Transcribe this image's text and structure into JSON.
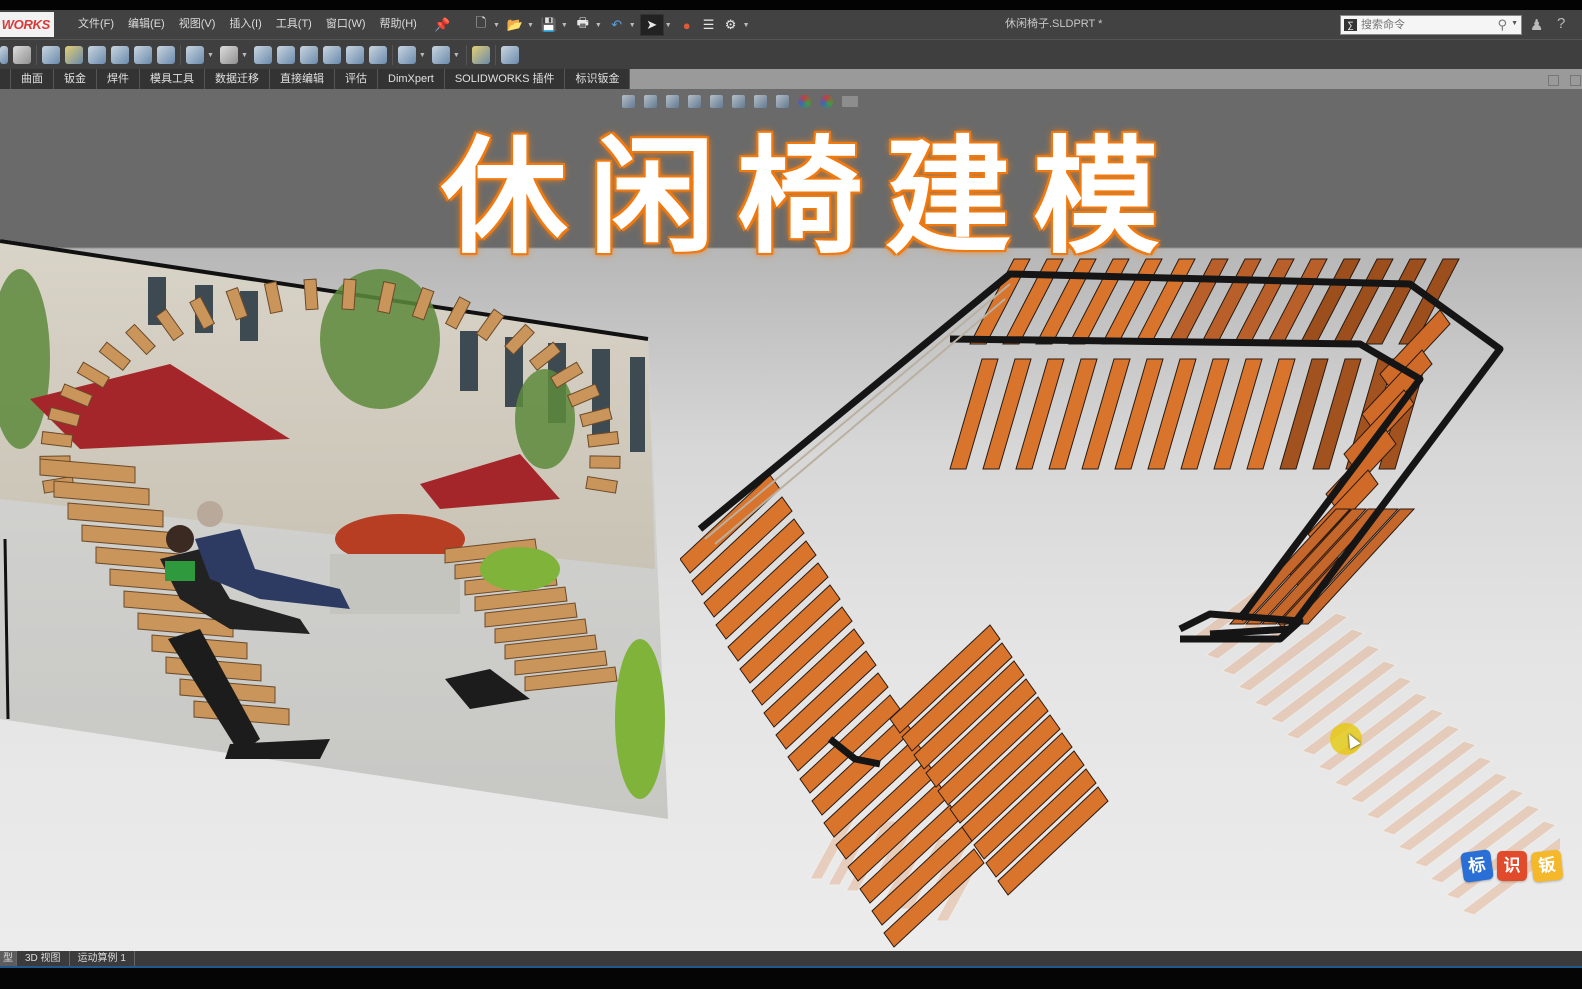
{
  "app": {
    "logo_text": "WORKS",
    "document_title": "休闲椅子.SLDPRT *"
  },
  "menu": [
    {
      "label": "文件(F)"
    },
    {
      "label": "编辑(E)"
    },
    {
      "label": "视图(V)"
    },
    {
      "label": "插入(I)"
    },
    {
      "label": "工具(T)"
    },
    {
      "label": "窗口(W)"
    },
    {
      "label": "帮助(H)"
    }
  ],
  "quick_access": [
    "new-document-icon",
    "open-icon",
    "save-icon",
    "print-icon",
    "undo-icon",
    "select-pointer-icon",
    "rebuild-traffic-light-icon",
    "file-properties-icon",
    "options-gear-icon"
  ],
  "search": {
    "placeholder": "搜索命令"
  },
  "command_tabs": [
    {
      "label": ""
    },
    {
      "label": "曲面"
    },
    {
      "label": "钣金"
    },
    {
      "label": "焊件"
    },
    {
      "label": "模具工具"
    },
    {
      "label": "数据迁移"
    },
    {
      "label": "直接编辑"
    },
    {
      "label": "评估"
    },
    {
      "label": "DimXpert"
    },
    {
      "label": "SOLIDWORKS 插件"
    },
    {
      "label": "标识钣金"
    }
  ],
  "viewport": {
    "banner_title": "休闲椅建模",
    "reference_photo_alt": "户外休闲椅参考照片",
    "model_alt": "休闲椅三维模型",
    "accent_color": "#f07a12",
    "wood_color": "#d9742d"
  },
  "watermark": {
    "chars": [
      "标",
      "识",
      "钣"
    ],
    "colors": [
      "#2a6fd6",
      "#e24a2c",
      "#f4b82a"
    ]
  },
  "status_tabs": [
    {
      "label": "型"
    },
    {
      "label": "3D 视图"
    },
    {
      "label": "运动算例 1"
    }
  ]
}
